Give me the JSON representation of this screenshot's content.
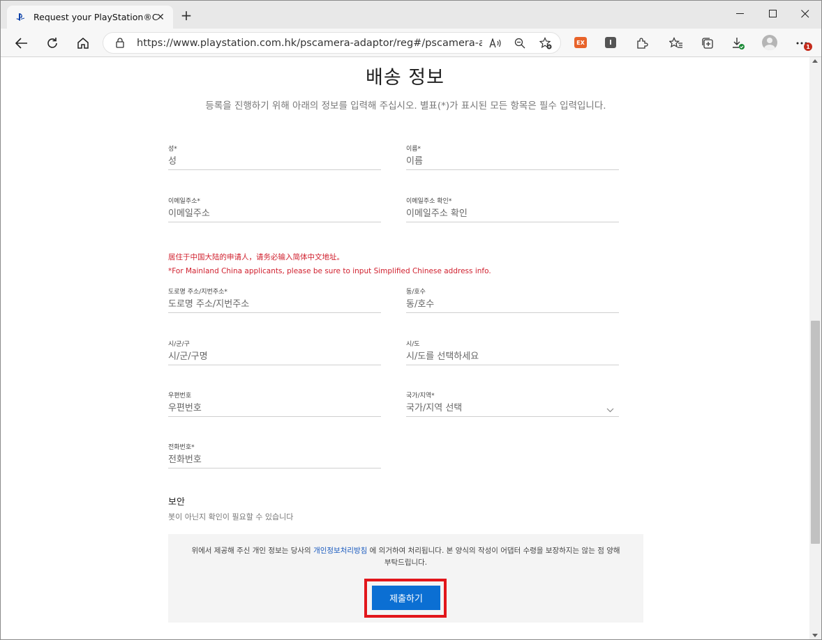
{
  "browser": {
    "tab_title": "Request your PlayStation®Camera",
    "url": "https://www.playstation.com.hk/pscamera-adaptor/reg#/pscamera-adaptor/re...",
    "notification_count": "1"
  },
  "page": {
    "title": "배송 정보",
    "subtitle": "등록을 진행하기 위해 아래의 정보를 입력해 주십시오. 별표(*)가 표시된 모든 항목은 필수 입력입니다.",
    "fields": {
      "last_name": {
        "label": "성*",
        "placeholder": "성"
      },
      "first_name": {
        "label": "이름*",
        "placeholder": "이름"
      },
      "email": {
        "label": "이메일주소*",
        "placeholder": "이메일주소"
      },
      "email_confirm": {
        "label": "이메일주소 확인*",
        "placeholder": "이메일주소 확인"
      },
      "address": {
        "label": "도로명 주소/지번주소*",
        "placeholder": "도로명 주소/지번주소"
      },
      "unit": {
        "label": "동/호수",
        "placeholder": "동/호수"
      },
      "city": {
        "label": "시/군/구",
        "placeholder": "시/군/구명"
      },
      "province": {
        "label": "시/도",
        "placeholder": "시/도를 선택하세요"
      },
      "postal": {
        "label": "우편번호",
        "placeholder": "우편번호"
      },
      "country": {
        "label": "국가/지역*",
        "placeholder": "국가/지역 선택"
      },
      "phone": {
        "label": "전화번호*",
        "placeholder": "전화번호"
      }
    },
    "warning_cn": "居住于中国大陆的申请人，请务必输入简体中文地址。",
    "warning_en": "*For Mainland China applicants, please be sure to input Simplified Chinese address info.",
    "security": {
      "title": "보안",
      "desc": "봇이 아닌지 확인이 필요할 수 있습니다"
    },
    "notice": {
      "text_before": "위에서 제공해 주신 개인 정보는 당사의 ",
      "link": "개인정보처리방침",
      "text_after": " 에 의거하여 처리됩니다. 본 양식의 작성이 어댑터 수령을 보장하지는 않는 점 양해 부탁드립니다."
    },
    "submit_label": "제출하기"
  },
  "colors": {
    "accent": "#0b6fd3",
    "warning": "#d0202e",
    "highlight": "#e2161b"
  }
}
